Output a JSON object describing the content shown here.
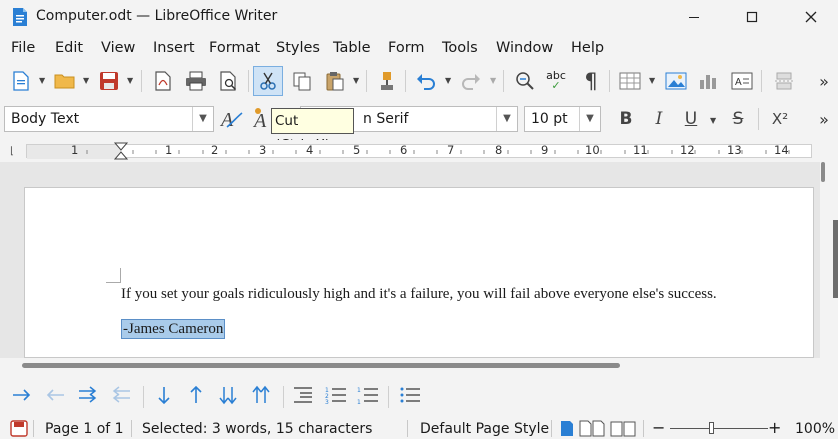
{
  "window": {
    "title": "Computer.odt — LibreOffice Writer"
  },
  "menu": [
    "File",
    "Edit",
    "View",
    "Insert",
    "Format",
    "Styles",
    "Table",
    "Form",
    "Tools",
    "Window",
    "Help"
  ],
  "formatting": {
    "paragraph_style": "Body Text",
    "font_name_visible": "n Serif",
    "font_size": "10 pt",
    "italic_label": "I",
    "underline_label": "U",
    "bold_label": "B",
    "strike_label": "S",
    "superscript_label": "X²"
  },
  "tooltip": "Cut (Ctrl+X)",
  "ruler": {
    "labels": [
      "1",
      "1",
      "2",
      "3",
      "4",
      "5",
      "6",
      "7",
      "8",
      "9",
      "10",
      "11",
      "12",
      "13",
      "14"
    ]
  },
  "document": {
    "paragraph": "If you set your goals ridiculously high and it's a failure, you will fail above everyone else's success.",
    "signature": "-James Cameron"
  },
  "status": {
    "page": "Page 1 of 1",
    "selection": "Selected: 3 words, 15 characters",
    "page_style": "Default Page Style",
    "zoom": "100%"
  },
  "colors": {
    "accent": "#1e6fbf",
    "selection": "#a9cbea",
    "save_red": "#c0392b"
  }
}
